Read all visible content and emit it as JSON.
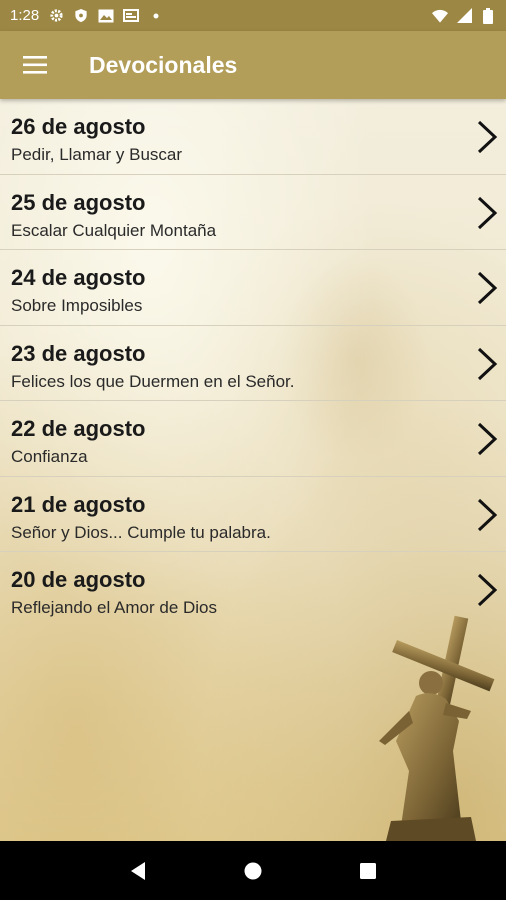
{
  "status_bar": {
    "time": "1:28",
    "icons": [
      "gear-icon",
      "shield-icon",
      "image-icon",
      "card-icon",
      "dot-icon"
    ],
    "right_icons": [
      "wifi-icon",
      "signal-icon",
      "battery-icon"
    ]
  },
  "app_bar": {
    "title": "Devocionales",
    "menu_icon": "hamburger-menu-icon"
  },
  "devotionals": [
    {
      "date": "26 de agosto",
      "title": "Pedir, Llamar y Buscar"
    },
    {
      "date": "25 de agosto",
      "title": "Escalar Cualquier Montaña"
    },
    {
      "date": "24 de agosto",
      "title": "Sobre Imposibles"
    },
    {
      "date": "23 de agosto",
      "title": "Felices los que Duermen en el Señor."
    },
    {
      "date": "22 de agosto",
      "title": "Confianza"
    },
    {
      "date": "21 de agosto",
      "title": "Señor y Dios... Cumple tu palabra."
    },
    {
      "date": "20 de agosto",
      "title": "Reflejando el Amor de Dios"
    }
  ],
  "colors": {
    "status_bar": "#9c8744",
    "app_bar": "#b29e58",
    "parchment": "#efe7cf"
  },
  "nav_bar": {
    "icons": [
      "back-icon",
      "home-icon",
      "recents-icon"
    ]
  }
}
